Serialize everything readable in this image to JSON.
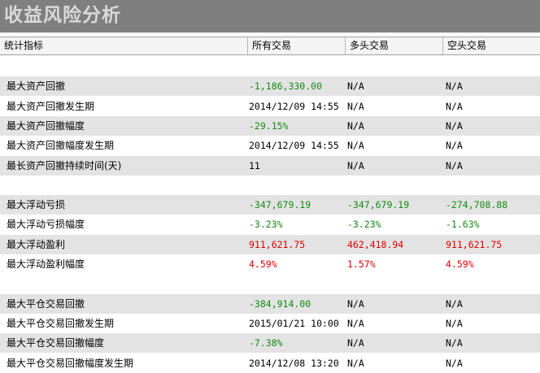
{
  "title": "收益风险分析",
  "columns": [
    "统计指标",
    "所有交易",
    "多头交易",
    "空头交易"
  ],
  "rows": [
    {
      "shaded": false,
      "cells": [
        "",
        "",
        "",
        ""
      ],
      "colors": [
        "black",
        "black",
        "black",
        "black"
      ]
    },
    {
      "shaded": true,
      "cells": [
        "最大资产回撤",
        "-1,186,330.00",
        "N/A",
        "N/A"
      ],
      "colors": [
        "black",
        "green",
        "black",
        "black"
      ]
    },
    {
      "shaded": false,
      "cells": [
        "最大资产回撤发生期",
        "2014/12/09 14:55",
        "N/A",
        "N/A"
      ],
      "colors": [
        "black",
        "black",
        "black",
        "black"
      ]
    },
    {
      "shaded": true,
      "cells": [
        "最大资产回撤幅度",
        "-29.15%",
        "N/A",
        "N/A"
      ],
      "colors": [
        "black",
        "green",
        "black",
        "black"
      ]
    },
    {
      "shaded": false,
      "cells": [
        "最大资产回撤幅度发生期",
        "2014/12/09 14:55",
        "N/A",
        "N/A"
      ],
      "colors": [
        "black",
        "black",
        "black",
        "black"
      ]
    },
    {
      "shaded": true,
      "cells": [
        "最长资产回撤持续时间(天)",
        "11",
        "N/A",
        "N/A"
      ],
      "colors": [
        "black",
        "black",
        "black",
        "black"
      ]
    },
    {
      "shaded": false,
      "cells": [
        "",
        "",
        "",
        ""
      ],
      "colors": [
        "black",
        "black",
        "black",
        "black"
      ]
    },
    {
      "shaded": true,
      "cells": [
        "最大浮动亏损",
        "-347,679.19",
        "-347,679.19",
        "-274,708.88"
      ],
      "colors": [
        "black",
        "green",
        "green",
        "green"
      ]
    },
    {
      "shaded": false,
      "cells": [
        "最大浮动亏损幅度",
        "-3.23%",
        "-3.23%",
        "-1.63%"
      ],
      "colors": [
        "black",
        "green",
        "green",
        "green"
      ]
    },
    {
      "shaded": true,
      "cells": [
        "最大浮动盈利",
        "911,621.75",
        "462,418.94",
        "911,621.75"
      ],
      "colors": [
        "black",
        "red",
        "red",
        "red"
      ]
    },
    {
      "shaded": false,
      "cells": [
        "最大浮动盈利幅度",
        "4.59%",
        "1.57%",
        "4.59%"
      ],
      "colors": [
        "black",
        "red",
        "red",
        "red"
      ]
    },
    {
      "shaded": false,
      "cells": [
        "",
        "",
        "",
        ""
      ],
      "colors": [
        "black",
        "black",
        "black",
        "black"
      ]
    },
    {
      "shaded": true,
      "cells": [
        "最大平仓交易回撤",
        "-384,914.00",
        "N/A",
        "N/A"
      ],
      "colors": [
        "black",
        "green",
        "black",
        "black"
      ]
    },
    {
      "shaded": false,
      "cells": [
        "最大平仓交易回撤发生期",
        "2015/01/21 10:00",
        "N/A",
        "N/A"
      ],
      "colors": [
        "black",
        "black",
        "black",
        "black"
      ]
    },
    {
      "shaded": true,
      "cells": [
        "最大平仓交易回撤幅度",
        "-7.38%",
        "N/A",
        "N/A"
      ],
      "colors": [
        "black",
        "green",
        "black",
        "black"
      ]
    },
    {
      "shaded": false,
      "cells": [
        "最大平仓交易回撤幅度发生期",
        "2014/12/08 13:20",
        "N/A",
        "N/A"
      ],
      "colors": [
        "black",
        "black",
        "black",
        "black"
      ]
    }
  ]
}
